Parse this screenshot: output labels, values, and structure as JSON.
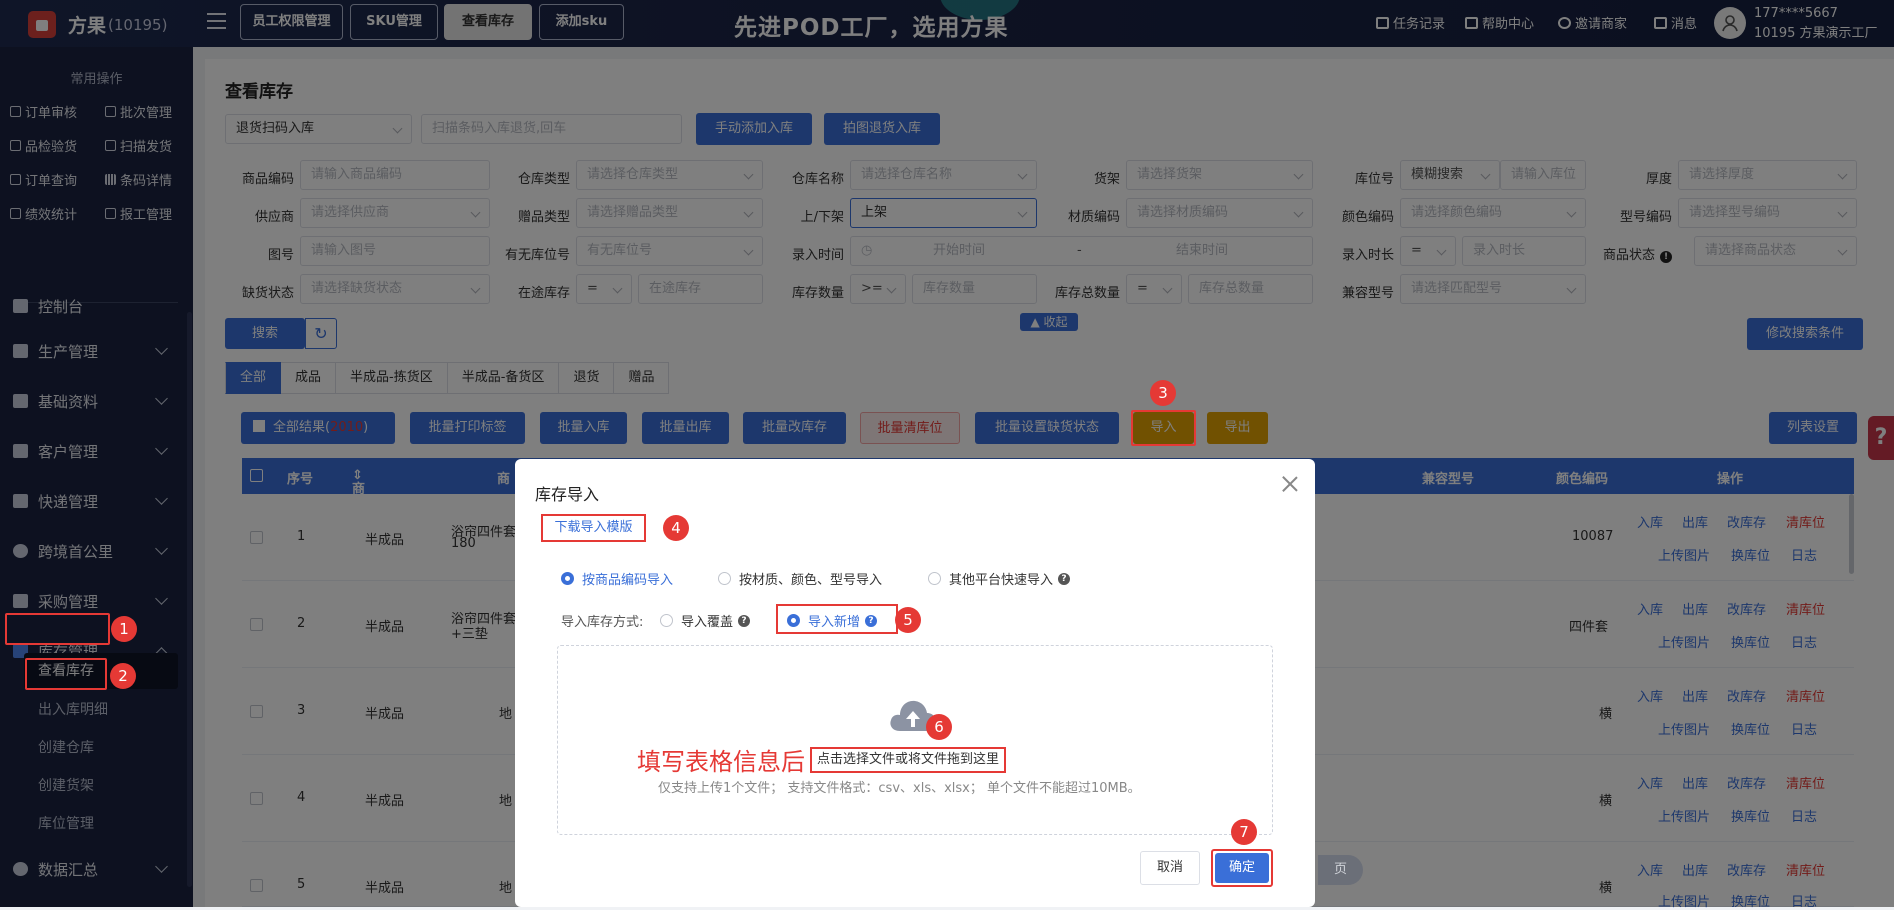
{
  "top": {
    "logo": "方果",
    "logo_id": "(10195)",
    "nav": [
      "员工权限管理",
      "SKU管理",
      "查看库存",
      "添加sku"
    ],
    "slogan": "先进POD工厂，选用方果",
    "links": [
      "任务记录",
      "帮助中心",
      "邀请商家",
      "消息"
    ],
    "user_phone": "177****5667",
    "user_name": "10195 方果演示工厂"
  },
  "sidebar": {
    "title": "常用操作",
    "quick_ops": [
      "订单审核",
      "批次管理",
      "品检验货",
      "扫描发货",
      "订单查询",
      "条码详情",
      "绩效统计",
      "报工管理"
    ],
    "menus": [
      "控制台",
      "生产管理",
      "基础资料",
      "客户管理",
      "快递管理",
      "跨境首公里",
      "采购管理",
      "库存管理",
      "数据汇总"
    ],
    "submenus": [
      "查看库存",
      "出入库明细",
      "创建仓库",
      "创建货架",
      "库位管理"
    ]
  },
  "page": {
    "title": "查看库存",
    "scan_select": "退货扫码入库",
    "scan_placeholder": "扫描条码入库退货,回车",
    "btn_manual": "手动添加入库",
    "btn_photo": "拍图退货入库",
    "filters": {
      "labels": [
        "商品编码",
        "仓库类型",
        "仓库名称",
        "货架",
        "库位号",
        "厚度",
        "供应商",
        "赠品类型",
        "上/下架",
        "材质编码",
        "颜色编码",
        "型号编码",
        "图号",
        "有无库位号",
        "录入时间",
        "录入时长",
        "商品状态",
        "缺货状态",
        "在途库存",
        "库存数量",
        "库存总数量",
        "兼容型号"
      ],
      "ph_goods_code": "请输入商品编码",
      "ph_wh_type": "请选择仓库类型",
      "ph_wh_name": "请选择仓库名称",
      "ph_shelf": "请选择货架",
      "loc_mode": "模糊搜索",
      "ph_loc": "请输入库位",
      "ph_thickness": "请选择厚度",
      "ph_supplier": "请选择供应商",
      "ph_gift": "请选择赠品类型",
      "updown": "上架",
      "ph_material": "请选择材质编码",
      "ph_color": "请选择颜色编码",
      "ph_model": "请选择型号编码",
      "ph_figure": "请输入图号",
      "ph_has_loc": "有无库位号",
      "ph_start": "开始时间",
      "range_sep": "-",
      "ph_end": "结束时间",
      "eq": "=",
      "ph_duration": "录入时长",
      "ph_status": "请选择商品状态",
      "ph_stockout": "请选择缺货状态",
      "ph_transit": "在途库存",
      "gte": ">=",
      "ph_qty": "库存数量",
      "ph_total": "库存总数量",
      "ph_compat": "请选择匹配型号"
    },
    "collapse": "收起",
    "btn_search": "搜索",
    "btn_modify": "修改搜索条件",
    "tabs": [
      "全部",
      "成品",
      "半成品-拣货区",
      "半成品-备货区",
      "退货",
      "赠品"
    ],
    "toolbar": {
      "all_results": "全部结果(",
      "all_count": "2010",
      "all_close": ")",
      "print": "批量打印标签",
      "in": "批量入库",
      "out": "批量出库",
      "change": "批量改库存",
      "clear": "批量清库位",
      "stockout": "批量设置缺货状态",
      "import": "导入",
      "export": "导出",
      "columns": "列表设置"
    },
    "table": {
      "headers": [
        "序号",
        "商品类型",
        "商",
        "兼容型号",
        "颜色编码",
        "操作"
      ],
      "rows": [
        {
          "no": "1",
          "type": "半成品",
          "name1": "浴帘四件套",
          "name2": "180",
          "color": "10087"
        },
        {
          "no": "2",
          "type": "半成品",
          "name1": "浴帘四件套",
          "name2": "+三垫",
          "color": "四件套"
        },
        {
          "no": "3",
          "type": "半成品",
          "name1": "地",
          "name2": "",
          "color": "横"
        },
        {
          "no": "4",
          "type": "半成品",
          "name1": "地",
          "name2": "",
          "color": "横"
        },
        {
          "no": "5",
          "type": "半成品",
          "name1": "地",
          "name2": "",
          "color": "横"
        }
      ],
      "ops": [
        "入库",
        "出库",
        "改库存",
        "清库位",
        "上传图片",
        "换库位",
        "日志"
      ]
    },
    "pager_suffix": "页"
  },
  "dialog": {
    "title": "库存导入",
    "download": "下载导入模版",
    "radio_code": "按商品编码导入",
    "radio_material": "按材质、颜色、型号导入",
    "radio_other": "其他平台快速导入",
    "method_label": "导入库存方式:",
    "cover": "导入覆盖",
    "add": "导入新增",
    "annotation": "填写表格信息后",
    "upload_text": "点击选择文件或将文件拖到这里",
    "upload_hint": "仅支持上传1个文件；  支持文件格式：csv、xls、xlsx；  单个文件不能超过10MB。",
    "cancel": "取消",
    "confirm": "确定"
  },
  "steps": [
    "1",
    "2",
    "3",
    "4",
    "5",
    "6",
    "7"
  ],
  "colors": {
    "primary": "#3a6fd8",
    "annot": "#e53935",
    "import": "#e2a203",
    "topbar": "#1e2b50"
  }
}
